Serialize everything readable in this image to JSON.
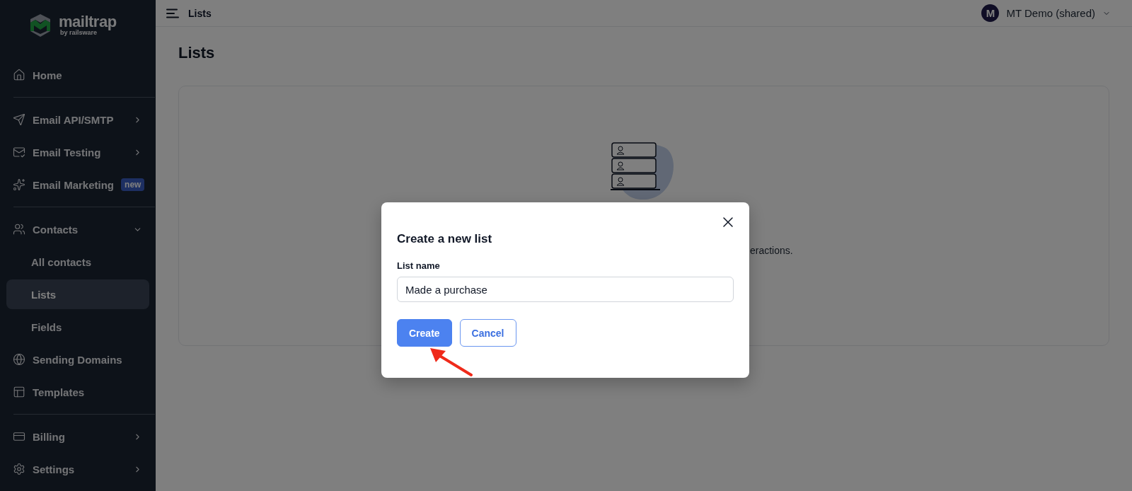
{
  "sidebar": {
    "logo": {
      "name": "mailtrap",
      "tagline": "by railsware"
    },
    "groups": [
      [
        {
          "label": "Home",
          "selected": false
        }
      ],
      [
        {
          "label": "Email API/SMTP",
          "selected": false,
          "expanded": false
        },
        {
          "label": "Email Testing",
          "selected": false,
          "expanded": false
        },
        {
          "label": "Email Marketing",
          "selected": false,
          "badge": "new"
        }
      ],
      [
        {
          "label": "Contacts",
          "selected": false,
          "expanded": true,
          "children": [
            {
              "label": "All contacts",
              "selected": false
            },
            {
              "label": "Lists",
              "selected": true
            },
            {
              "label": "Fields",
              "selected": false
            }
          ]
        },
        {
          "label": "Sending Domains",
          "selected": false
        },
        {
          "label": "Templates",
          "selected": false
        }
      ],
      [
        {
          "label": "Billing",
          "selected": false,
          "expanded": false
        },
        {
          "label": "Settings",
          "selected": false,
          "expanded": false
        }
      ]
    ]
  },
  "header": {
    "breadcrumb": "Lists",
    "account": {
      "initial": "M",
      "name": "MT Demo (shared)"
    }
  },
  "page": {
    "title": "Lists",
    "empty_state": {
      "text_fragment": "eractions."
    }
  },
  "modal": {
    "title": "Create a new list",
    "field": {
      "label": "List name",
      "value": "Made a purchase"
    },
    "buttons": [
      {
        "label": "Create",
        "kind": "primary"
      },
      {
        "label": "Cancel",
        "kind": "secondary"
      }
    ]
  }
}
